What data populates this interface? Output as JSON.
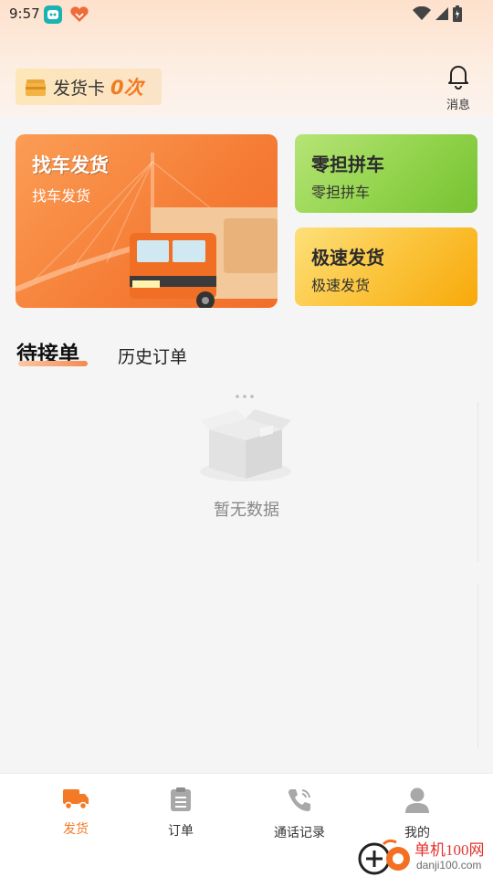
{
  "status_bar": {
    "time": "9:57"
  },
  "header": {
    "ship_card_label": "发货卡",
    "ship_card_count": "0次",
    "message_label": "消息"
  },
  "cards": {
    "find_truck": {
      "title": "找车发货",
      "subtitle": "找车发货"
    },
    "less_than_load": {
      "title": "零担拼车",
      "subtitle": "零担拼车"
    },
    "express_ship": {
      "title": "极速发货",
      "subtitle": "极速发货"
    }
  },
  "tabs": {
    "pending": "待接单",
    "history": "历史订单"
  },
  "empty_state": {
    "text": "暂无数据"
  },
  "bottom_nav": {
    "items": [
      {
        "label": "发货",
        "icon": "truck-icon",
        "active": true
      },
      {
        "label": "订单",
        "icon": "clipboard-icon",
        "active": false
      },
      {
        "label": "通话记录",
        "icon": "phone-icon",
        "active": false
      },
      {
        "label": "我的",
        "icon": "user-icon",
        "active": false
      }
    ]
  },
  "watermark": {
    "line1": "单机100网",
    "line2": "danji100.com"
  },
  "colors": {
    "accent": "#f57a25",
    "header_bg": "#fde1cc",
    "page_bg": "#f5f5f5",
    "green_card": "#95d54f",
    "yellow_card": "#fbc43c"
  }
}
